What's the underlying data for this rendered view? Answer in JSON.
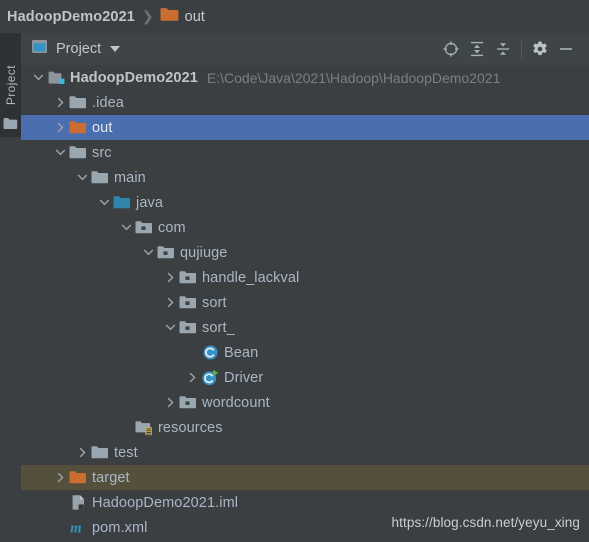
{
  "breadcrumb": {
    "root": "HadoopDemo2021",
    "separator": "❯",
    "leaf": "out",
    "leaf_icon": "folder-orange-icon"
  },
  "tool_strip": {
    "tab_label": "Project",
    "icon": "folder-icon"
  },
  "tool_window": {
    "title": "Project",
    "title_icon": "project-window-icon",
    "caret_icon": "chevron-down-icon",
    "actions": [
      {
        "name": "select-opened-file-button",
        "icon": "crosshair-icon",
        "tooltip": "Select Opened File"
      },
      {
        "name": "expand-all-button",
        "icon": "expand-all-icon",
        "tooltip": "Expand All"
      },
      {
        "name": "collapse-all-button",
        "icon": "collapse-all-icon",
        "tooltip": "Collapse All"
      },
      {
        "name": "settings-button",
        "icon": "gear-icon",
        "tooltip": "Settings"
      },
      {
        "name": "hide-button",
        "icon": "minimize-icon",
        "tooltip": "Hide"
      }
    ]
  },
  "colors": {
    "background": "#3c3f41",
    "header_background": "#3f4447",
    "selection": "#4b6eaf",
    "hover": "#55503c",
    "text": "#a9b7c6",
    "text_dim": "#787f85",
    "folder_gray": "#9aa7b0",
    "folder_orange": "#cb6c30",
    "source_root_blue": "#3592c4",
    "class_icon_blue": "#3592c4",
    "run_badge_green": "#62b543",
    "maven_cyan": "#3592c4"
  },
  "tree": {
    "rows": [
      {
        "label": "HadoopDemo2021",
        "sublabel": "E:\\Code\\Java\\2021\\Hadoop\\HadoopDemo2021",
        "icon": "module-icon",
        "twisty": "expanded",
        "depth": 0,
        "bold": true,
        "state": "normal",
        "name": "tree-row-hadoopdemo2021"
      },
      {
        "label": ".idea",
        "sublabel": "",
        "icon": "folder-gray-icon",
        "twisty": "collapsed",
        "depth": 1,
        "bold": false,
        "state": "normal",
        "name": "tree-row-idea"
      },
      {
        "label": "out",
        "sublabel": "",
        "icon": "folder-orange-icon",
        "twisty": "collapsed",
        "depth": 1,
        "bold": false,
        "state": "selected",
        "name": "tree-row-out"
      },
      {
        "label": "src",
        "sublabel": "",
        "icon": "folder-gray-icon",
        "twisty": "expanded",
        "depth": 1,
        "bold": false,
        "state": "normal",
        "name": "tree-row-src"
      },
      {
        "label": "main",
        "sublabel": "",
        "icon": "folder-gray-icon",
        "twisty": "expanded",
        "depth": 2,
        "bold": false,
        "state": "normal",
        "name": "tree-row-main"
      },
      {
        "label": "java",
        "sublabel": "",
        "icon": "source-root-icon",
        "twisty": "expanded",
        "depth": 3,
        "bold": false,
        "state": "normal",
        "name": "tree-row-java"
      },
      {
        "label": "com",
        "sublabel": "",
        "icon": "package-icon",
        "twisty": "expanded",
        "depth": 4,
        "bold": false,
        "state": "normal",
        "name": "tree-row-com"
      },
      {
        "label": "qujiuge",
        "sublabel": "",
        "icon": "package-icon",
        "twisty": "expanded",
        "depth": 5,
        "bold": false,
        "state": "normal",
        "name": "tree-row-qujiuge"
      },
      {
        "label": "handle_lackval",
        "sublabel": "",
        "icon": "package-icon",
        "twisty": "collapsed",
        "depth": 6,
        "bold": false,
        "state": "normal",
        "name": "tree-row-handle-lackval"
      },
      {
        "label": "sort",
        "sublabel": "",
        "icon": "package-icon",
        "twisty": "collapsed",
        "depth": 6,
        "bold": false,
        "state": "normal",
        "name": "tree-row-sort"
      },
      {
        "label": "sort_",
        "sublabel": "",
        "icon": "package-icon",
        "twisty": "expanded",
        "depth": 6,
        "bold": false,
        "state": "normal",
        "name": "tree-row-sort-underscore"
      },
      {
        "label": "Bean",
        "sublabel": "",
        "icon": "java-class-icon",
        "twisty": "none",
        "depth": 7,
        "bold": false,
        "state": "normal",
        "name": "tree-row-bean"
      },
      {
        "label": "Driver",
        "sublabel": "",
        "icon": "java-class-runnable-icon",
        "twisty": "collapsed",
        "depth": 7,
        "bold": false,
        "state": "normal",
        "name": "tree-row-driver"
      },
      {
        "label": "wordcount",
        "sublabel": "",
        "icon": "package-icon",
        "twisty": "collapsed",
        "depth": 6,
        "bold": false,
        "state": "normal",
        "name": "tree-row-wordcount"
      },
      {
        "label": "resources",
        "sublabel": "",
        "icon": "resources-folder-icon",
        "twisty": "none",
        "depth": 4,
        "bold": false,
        "state": "normal",
        "name": "tree-row-resources"
      },
      {
        "label": "test",
        "sublabel": "",
        "icon": "folder-gray-icon",
        "twisty": "collapsed",
        "depth": 2,
        "bold": false,
        "state": "normal",
        "name": "tree-row-test"
      },
      {
        "label": "target",
        "sublabel": "",
        "icon": "folder-orange-icon",
        "twisty": "collapsed",
        "depth": 1,
        "bold": false,
        "state": "hovered",
        "name": "tree-row-target"
      },
      {
        "label": "HadoopDemo2021.iml",
        "sublabel": "",
        "icon": "iml-file-icon",
        "twisty": "none",
        "depth": 1,
        "bold": false,
        "state": "normal",
        "name": "tree-row-iml-file"
      },
      {
        "label": "pom.xml",
        "sublabel": "",
        "icon": "maven-pom-icon",
        "twisty": "none",
        "depth": 1,
        "bold": false,
        "state": "normal",
        "name": "tree-row-pom-xml"
      }
    ]
  },
  "watermark": {
    "text": "https://blog.csdn.net/yeyu_xing"
  }
}
